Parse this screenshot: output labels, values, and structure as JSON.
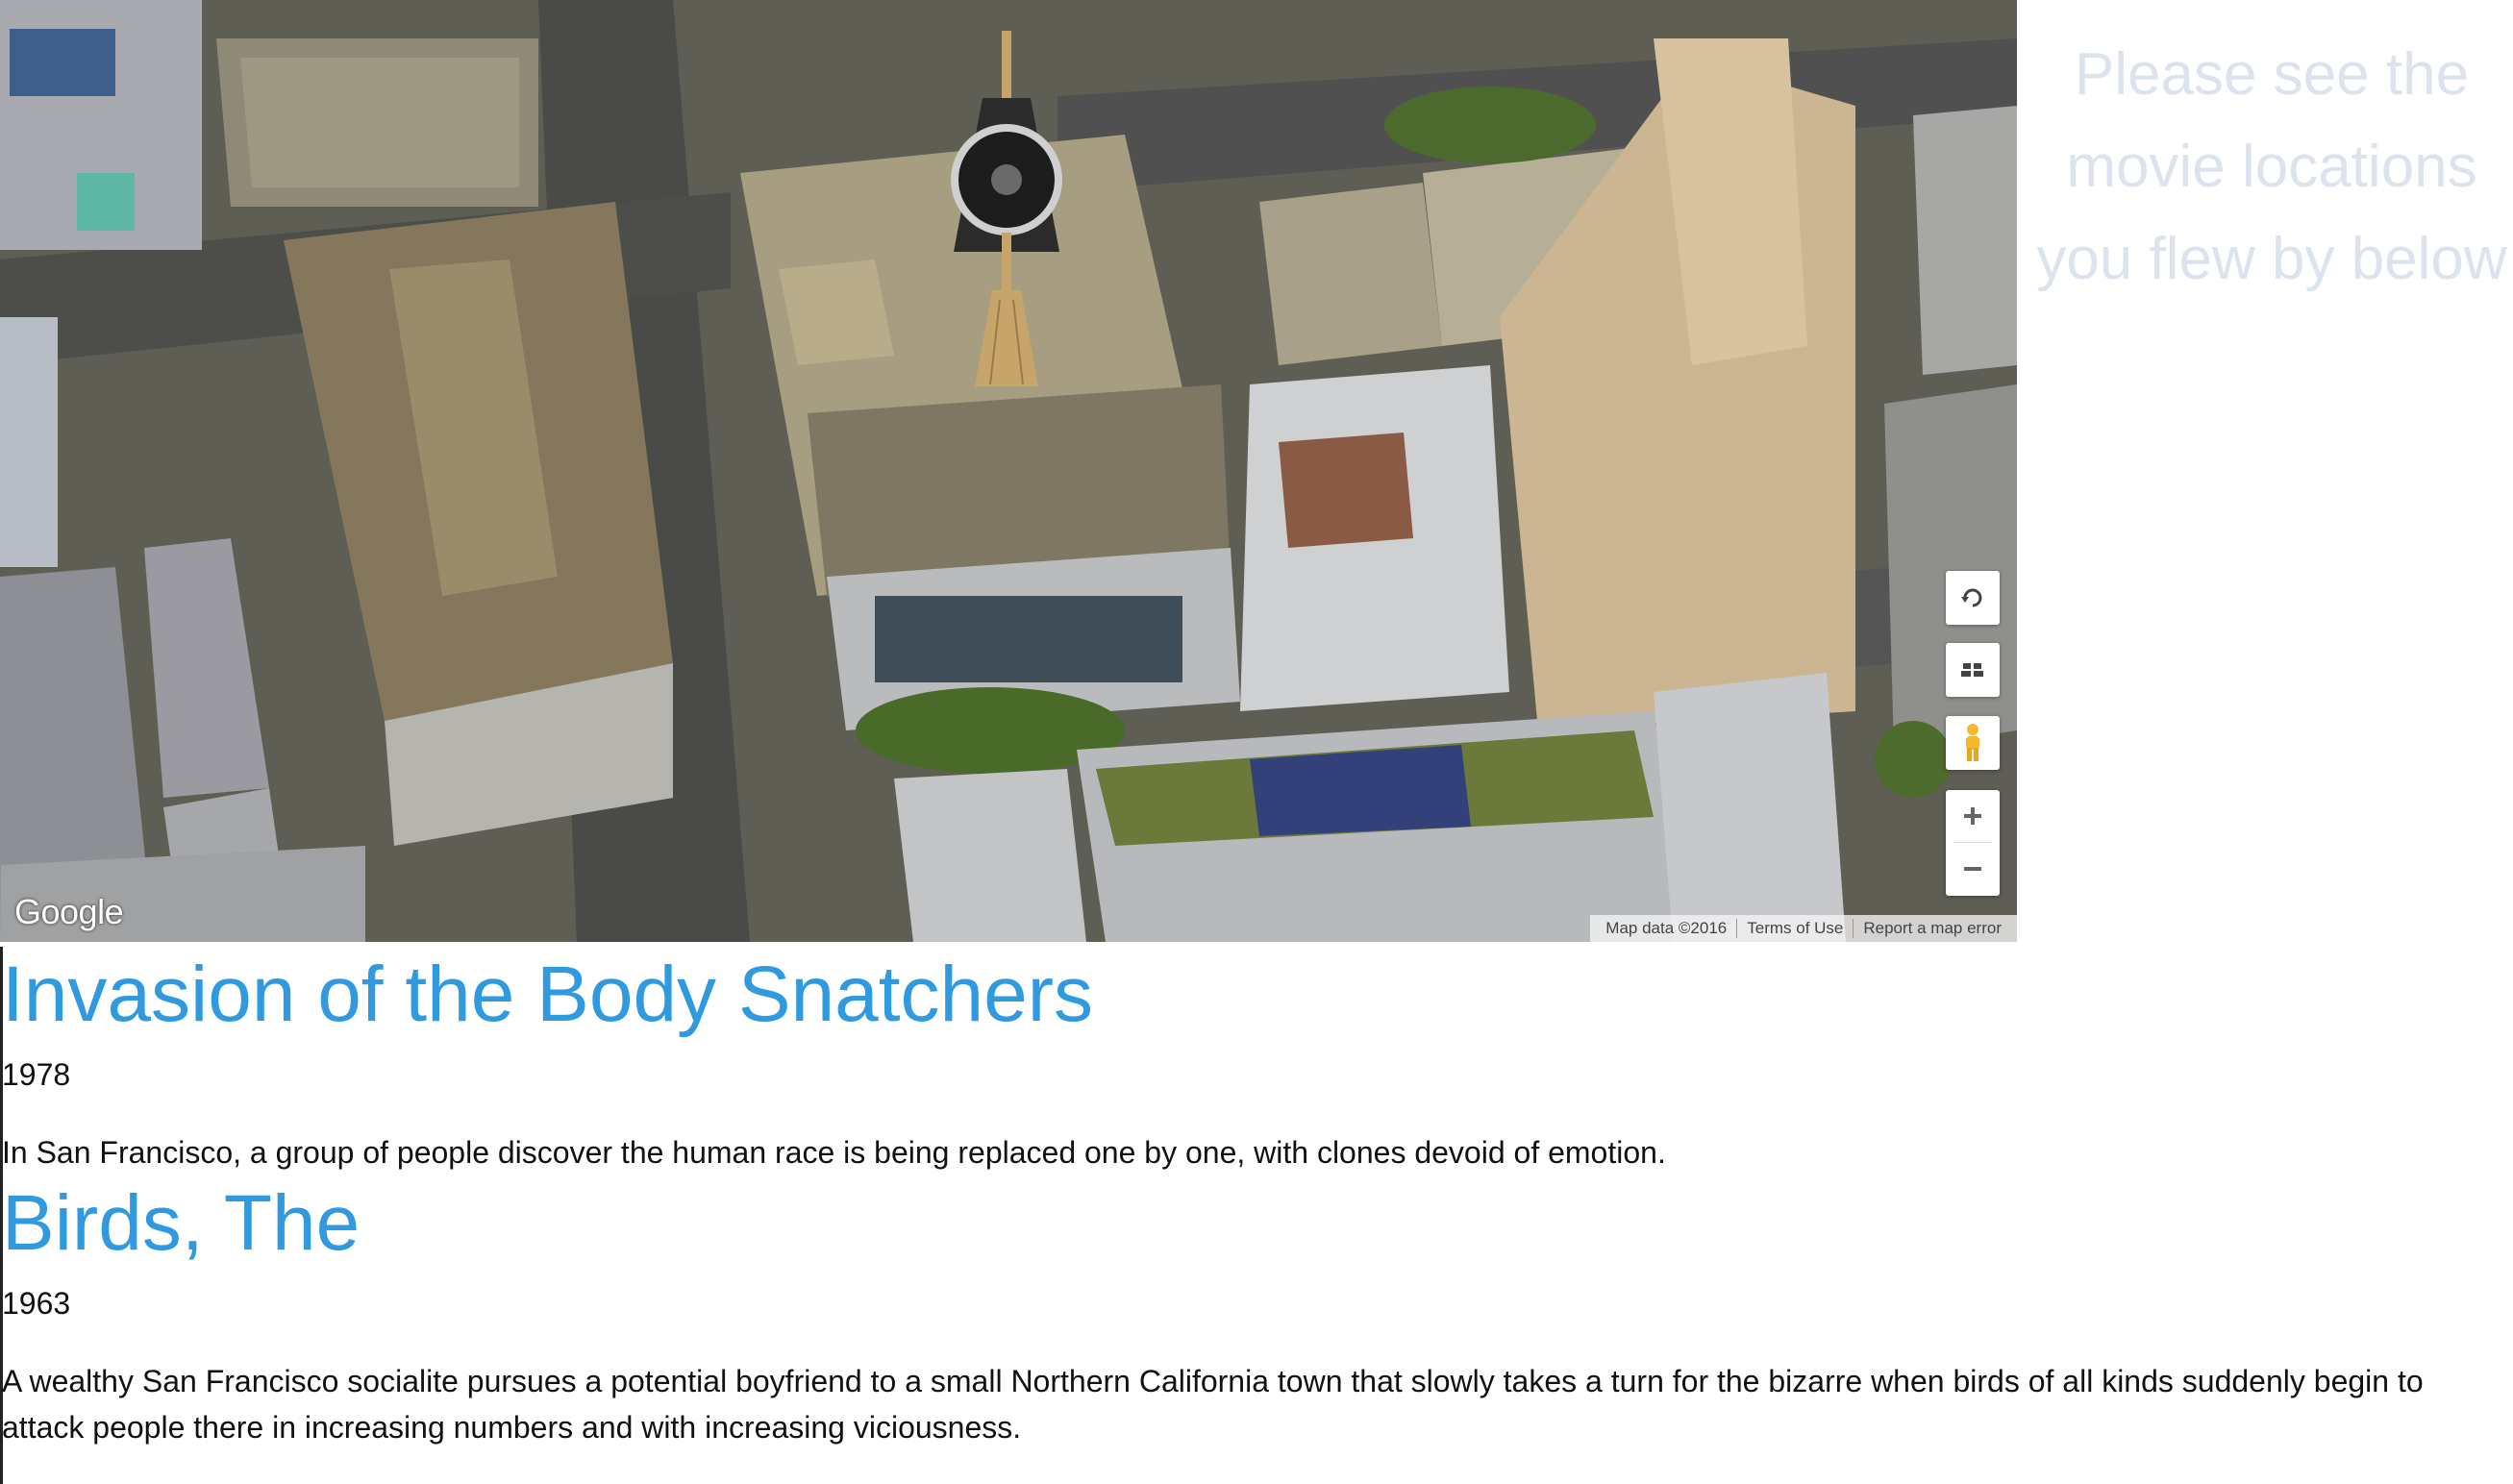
{
  "map": {
    "logo": "Google",
    "attribution": {
      "map_data": "Map data ©2016",
      "terms": "Terms of Use",
      "report": "Report a map error"
    },
    "controls": [
      "rotate-icon",
      "tilt-icon",
      "pegman-icon",
      "zoom-in-icon",
      "zoom-out-icon"
    ],
    "marker": "broom-marker-icon"
  },
  "side_note": {
    "line1": "Please see the",
    "line2": "movie locations",
    "line3": "you flew by below"
  },
  "movies": [
    {
      "title": "Invasion of the Body Snatchers",
      "year": "1978",
      "description": "In San Francisco, a group of people discover the human race is being replaced one by one, with clones devoid of emotion."
    },
    {
      "title": "Birds, The",
      "year": "1963",
      "description": "A wealthy San Francisco socialite pursues a potential boyfriend to a small Northern California town that slowly takes a turn for the bizarre when birds of all kinds suddenly begin to attack people there in increasing numbers and with increasing viciousness."
    }
  ],
  "colors": {
    "title_blue": "#2f9ae0",
    "side_note": "#dde3ee"
  }
}
